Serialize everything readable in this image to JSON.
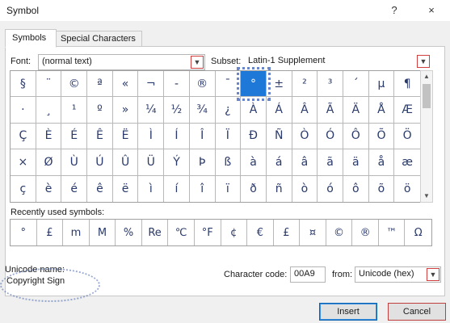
{
  "window": {
    "title": "Symbol",
    "help_label": "?",
    "close_label": "×"
  },
  "tabs": [
    {
      "label": "Symbols"
    },
    {
      "label": "Special Characters"
    }
  ],
  "font": {
    "label": "Font:",
    "value": "(normal text)"
  },
  "subset": {
    "label": "Subset:",
    "value": "Latin-1 Supplement"
  },
  "symbols": [
    [
      "§",
      "¨",
      "©",
      "ª",
      "«",
      "¬",
      "-",
      "®",
      "¯",
      "°",
      "±",
      "²",
      "³",
      "´",
      "µ",
      "¶"
    ],
    [
      "·",
      "¸",
      "¹",
      "º",
      "»",
      "¼",
      "½",
      "¾",
      "¿",
      "À",
      "Á",
      "Â",
      "Ã",
      "Ä",
      "Å",
      "Æ"
    ],
    [
      "Ç",
      "È",
      "É",
      "Ê",
      "Ë",
      "Ì",
      "Í",
      "Î",
      "Ï",
      "Ð",
      "Ñ",
      "Ò",
      "Ó",
      "Ô",
      "Õ",
      "Ö"
    ],
    [
      "×",
      "Ø",
      "Ù",
      "Ú",
      "Û",
      "Ü",
      "Ý",
      "Þ",
      "ß",
      "à",
      "á",
      "â",
      "ã",
      "ä",
      "å",
      "æ"
    ],
    [
      "ç",
      "è",
      "é",
      "ê",
      "ë",
      "ì",
      "í",
      "î",
      "ï",
      "ð",
      "ñ",
      "ò",
      "ó",
      "ô",
      "õ",
      "ö"
    ]
  ],
  "recent": {
    "label": "Recently used symbols:",
    "items": [
      "°",
      "£",
      "m",
      "M",
      "%",
      "Re",
      "℃",
      "°F",
      "¢",
      "€",
      "£",
      "¤",
      "©",
      "®",
      "™",
      "Ω"
    ]
  },
  "unicode_name": {
    "label": "Unicode name:",
    "value": "Copyright Sign"
  },
  "char_code": {
    "label": "Character code:",
    "value": "00A9"
  },
  "from": {
    "label": "from:",
    "value": "Unicode (hex)"
  },
  "buttons": {
    "insert": "Insert",
    "cancel": "Cancel"
  }
}
